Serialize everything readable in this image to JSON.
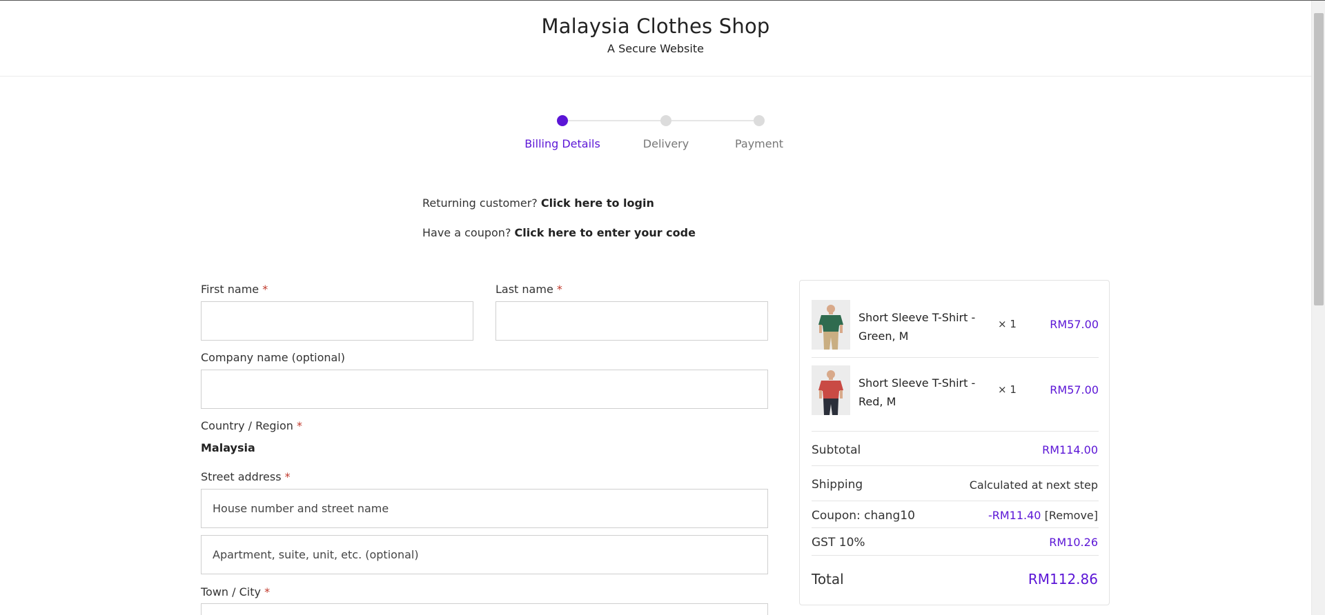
{
  "header": {
    "title": "Malaysia Clothes Shop",
    "subtitle": "A Secure Website"
  },
  "steps": [
    {
      "label": "Billing Details",
      "active": true
    },
    {
      "label": "Delivery",
      "active": false
    },
    {
      "label": "Payment",
      "active": false
    }
  ],
  "notices": {
    "returning_prefix": "Returning customer?",
    "returning_link": "Click here to login",
    "coupon_prefix": "Have a coupon?",
    "coupon_link": "Click here to enter your code"
  },
  "form": {
    "first_name_label": "First name",
    "last_name_label": "Last name",
    "company_label": "Company name (optional)",
    "country_label": "Country / Region",
    "country_value": "Malaysia",
    "street_label": "Street address",
    "street_placeholder": "House number and street name",
    "apartment_placeholder": "Apartment, suite, unit, etc. (optional)",
    "town_label": "Town / City",
    "required_mark": "*"
  },
  "order": {
    "items": [
      {
        "name": "Short Sleeve T-Shirt - Green, M",
        "qty": "× 1",
        "price": "RM57.00"
      },
      {
        "name": "Short Sleeve T-Shirt - Red, M",
        "qty": "× 1",
        "price": "RM57.00"
      }
    ],
    "subtotal_label": "Subtotal",
    "subtotal_value": "RM114.00",
    "shipping_label": "Shipping",
    "shipping_value": "Calculated at next step",
    "coupon_label": "Coupon: chang10",
    "coupon_value": "-RM11.40",
    "coupon_remove": "[Remove]",
    "gst_label": "GST 10%",
    "gst_value": "RM10.26",
    "total_label": "Total",
    "total_value": "RM112.86"
  },
  "colors": {
    "accent": "#5b15d6",
    "required": "#c0392b"
  },
  "icons": {
    "product_thumb": "product-thumbnail"
  }
}
